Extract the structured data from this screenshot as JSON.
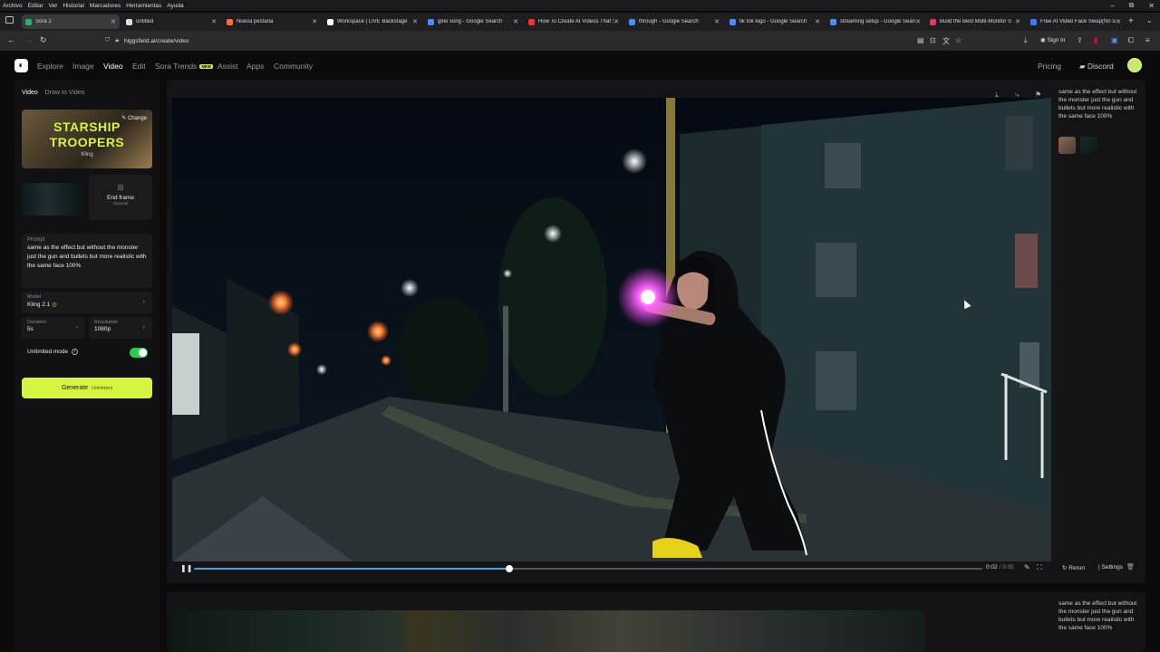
{
  "os_menu": [
    "Archivo",
    "Editar",
    "Ver",
    "Historial",
    "Marcadores",
    "Herramientas",
    "Ayuda"
  ],
  "window_controls": [
    "–",
    "⧉",
    "✕"
  ],
  "tabs": [
    {
      "label": "Sora 2",
      "color": "#24b36b",
      "active": true
    },
    {
      "label": "untitled",
      "color": "#dddddd"
    },
    {
      "label": "Nueva pestaña",
      "color": "#ff6b3d"
    },
    {
      "label": "Workspace | LIVE Backstage",
      "color": "#ffffff"
    },
    {
      "label": "girei song - Google Search",
      "color": "#4a8cff"
    },
    {
      "label": "How To Create AI Videos That S",
      "color": "#ff2d2d"
    },
    {
      "label": "through - Google Search",
      "color": "#4a8cff"
    },
    {
      "label": "tik tok logo - Google Search",
      "color": "#4a8cff"
    },
    {
      "label": "streaming setup - Google Searc",
      "color": "#4a8cff"
    },
    {
      "label": "Build the Best Multi-Monitor S",
      "color": "#e83a5a"
    },
    {
      "label": "Free AI Video Face Swap(No si",
      "color": "#3a7bff"
    }
  ],
  "browser": {
    "url": "higgsfield.ai/create/video",
    "signin": "Sign in"
  },
  "app_nav": {
    "links": [
      "Explore",
      "Image",
      "Video",
      "Edit",
      "Sora Trends",
      "Assist",
      "Apps",
      "Community"
    ],
    "active": "Video",
    "new_badge": "NEW",
    "pricing": "Pricing",
    "discord": "Discord"
  },
  "left_panel": {
    "tabs": [
      "Video",
      "Draw to Video"
    ],
    "preset_title_line1": "STARSHIP",
    "preset_title_line2": "TROOPERS",
    "preset_model": "Kling",
    "change_label": "Change",
    "end_frame_label": "End frame",
    "end_frame_sub": "Optional",
    "prompt_label": "Prompt",
    "prompt_text": "same as the effect but without the monster just the gun and bullets but more realistic with the same face 100%",
    "model_label": "Model",
    "model_value": "Kling 2.1",
    "duration_label": "Duration",
    "duration_value": "5s",
    "resolution_label": "Resolution",
    "resolution_value": "1080p",
    "unlimited_label": "Unlimited mode",
    "unlimited_on": true,
    "generate_label": "Generate",
    "generate_sub": "Unlimited"
  },
  "player": {
    "current_time": "0:02",
    "total_time": "0:05",
    "progress": 0.4,
    "rerun_label": "Rerun",
    "settings_label": "Settings"
  },
  "side_prompt_1": "same as the effect but without the monster just the gun and bullets but more realistic with the same face 100%",
  "side_prompt_2": "same as the effect but without the monster just the gun and bullets but more realistic with the same face 100%",
  "colors": {
    "accent": "#d5f543",
    "progress": "#3aa7e0",
    "toggle": "#2dcc4a"
  }
}
